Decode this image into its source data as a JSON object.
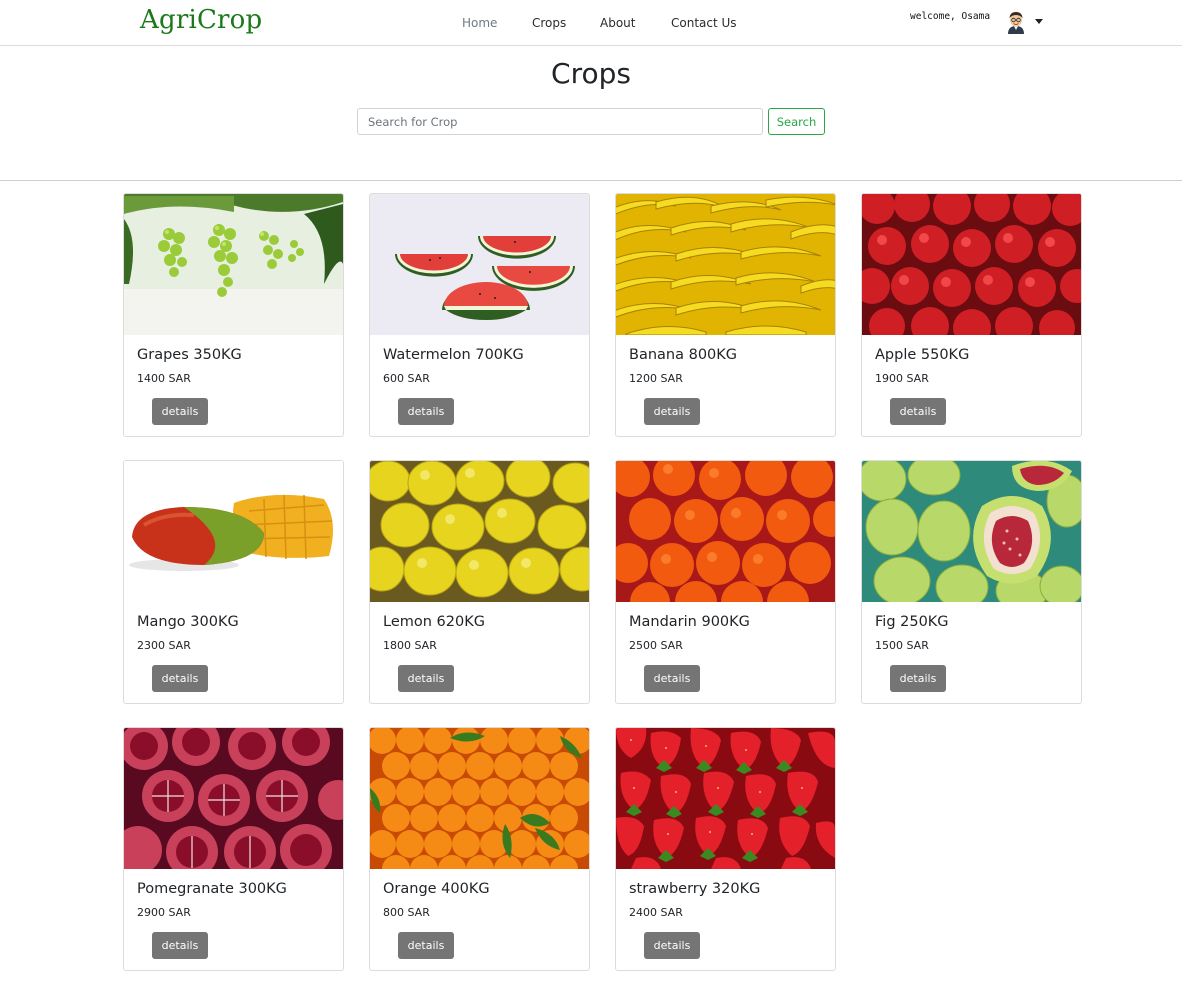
{
  "brand": "AgriCrop",
  "nav": {
    "home": "Home",
    "crops": "Crops",
    "about": "About",
    "contact": "Contact Us"
  },
  "user": {
    "welcome": "welcome, Osama"
  },
  "page": {
    "title": "Crops"
  },
  "search": {
    "placeholder": "Search for Crop",
    "button": "Search"
  },
  "crops": [
    {
      "title": "Grapes 350KG",
      "price": "1400 SAR",
      "button": "details",
      "image": "grapes"
    },
    {
      "title": "Watermelon 700KG",
      "price": "600 SAR",
      "button": "details",
      "image": "watermelon"
    },
    {
      "title": "Banana 800KG",
      "price": "1200 SAR",
      "button": "details",
      "image": "banana"
    },
    {
      "title": "Apple 550KG",
      "price": "1900 SAR",
      "button": "details",
      "image": "apple"
    },
    {
      "title": "Mango 300KG",
      "price": "2300 SAR",
      "button": "details",
      "image": "mango"
    },
    {
      "title": "Lemon 620KG",
      "price": "1800 SAR",
      "button": "details",
      "image": "lemon"
    },
    {
      "title": "Mandarin 900KG",
      "price": "2500 SAR",
      "button": "details",
      "image": "mandarin"
    },
    {
      "title": "Fig 250KG",
      "price": "1500 SAR",
      "button": "details",
      "image": "fig"
    },
    {
      "title": "Pomegranate 300KG",
      "price": "2900 SAR",
      "button": "details",
      "image": "pomegranate"
    },
    {
      "title": "Orange 400KG",
      "price": "800 SAR",
      "button": "details",
      "image": "orange"
    },
    {
      "title": "strawberry 320KG",
      "price": "2400 SAR",
      "button": "details",
      "image": "strawberry"
    }
  ],
  "colors": {
    "brand": "#1a7a1a",
    "search_accent": "#28a745",
    "details_button": "#757575"
  }
}
